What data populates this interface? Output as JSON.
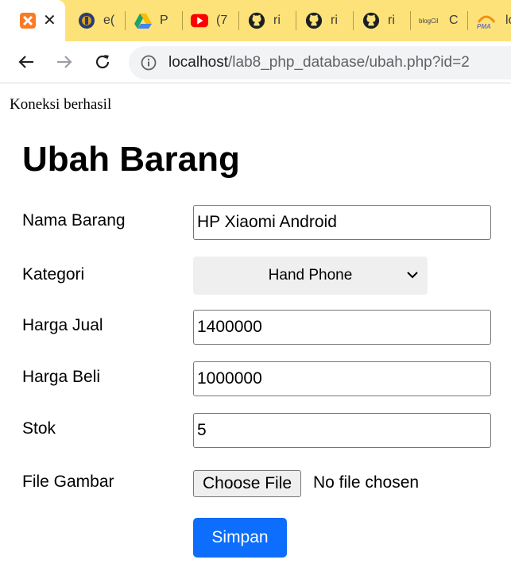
{
  "browser": {
    "tabs": [
      {
        "title": "",
        "icon": "xampp-icon",
        "active": true
      },
      {
        "title": "e(",
        "icon": "university-logo-icon"
      },
      {
        "title": "P",
        "icon": "google-drive-icon"
      },
      {
        "title": "(7",
        "icon": "youtube-icon"
      },
      {
        "title": "ri",
        "icon": "github-icon"
      },
      {
        "title": "ri",
        "icon": "github-icon"
      },
      {
        "title": "ri",
        "icon": "github-icon"
      },
      {
        "title": "C",
        "icon": "blog-icon",
        "icon_text": "blogCil"
      },
      {
        "title": "lo",
        "icon": "phpmyadmin-icon",
        "icon_text": "PMA"
      }
    ],
    "url_host": "localhost",
    "url_path": "/lab8_php_database/ubah.php?id=2",
    "colors": {
      "tabstrip": "#fde27a",
      "accent": "#0d6efd"
    }
  },
  "page": {
    "status": "Koneksi berhasil",
    "title": "Ubah Barang",
    "form": {
      "nama_label": "Nama Barang",
      "nama_value": "HP Xiaomi Android",
      "kategori_label": "Kategori",
      "kategori_value": "Hand Phone",
      "harga_jual_label": "Harga Jual",
      "harga_jual_value": "1400000",
      "harga_beli_label": "Harga Beli",
      "harga_beli_value": "1000000",
      "stok_label": "Stok",
      "stok_value": "5",
      "file_label": "File Gambar",
      "file_button": "Choose File",
      "file_status": "No file chosen",
      "submit_label": "Simpan"
    }
  }
}
